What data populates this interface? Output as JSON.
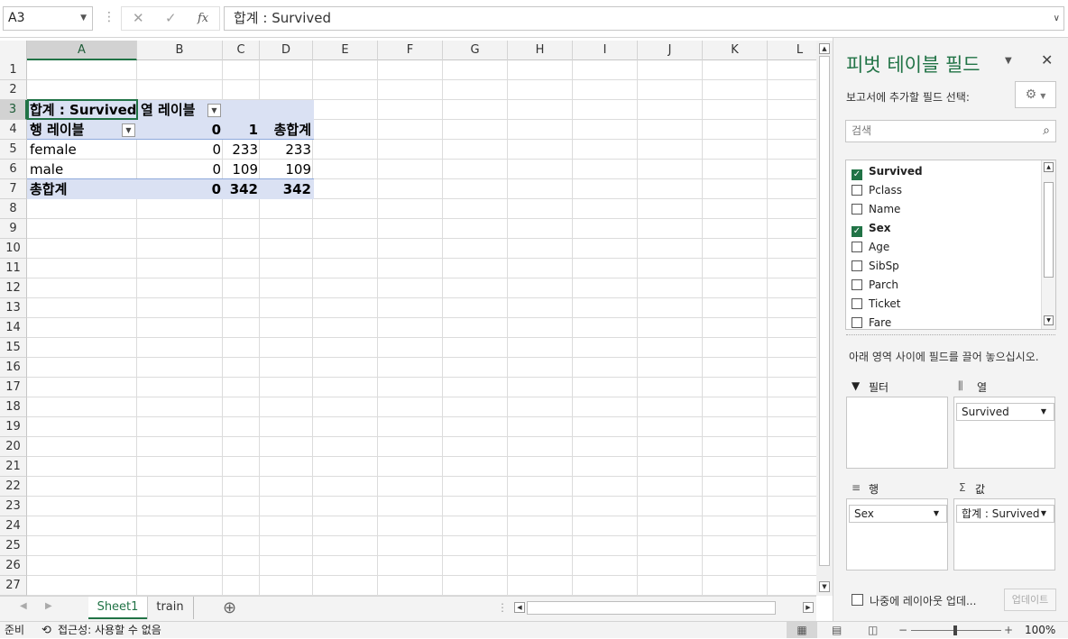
{
  "formula_bar": {
    "name_box": "A3",
    "cancel_icon": "✕",
    "enter_icon": "✓",
    "fx_icon": "fx",
    "formula": "합계 : Survived"
  },
  "sheet": {
    "columns": [
      "A",
      "B",
      "C",
      "D",
      "E",
      "F",
      "G",
      "H",
      "I",
      "J",
      "K",
      "L"
    ],
    "selected_column": "A",
    "rows": [
      "1",
      "2",
      "3",
      "4",
      "5",
      "6",
      "7",
      "8",
      "9",
      "10",
      "11",
      "12",
      "13",
      "14",
      "15",
      "16",
      "17",
      "18",
      "19",
      "20",
      "21",
      "22",
      "23",
      "24",
      "25",
      "26",
      "27"
    ],
    "selected_row": "3",
    "pivot": {
      "value_header": "합계 : Survived",
      "col_labels_header": "열 레이블",
      "row_labels_header": "행 레이블",
      "col_values": [
        "0",
        "1",
        "총합계"
      ],
      "rows": [
        {
          "label": "female",
          "values": [
            "0",
            "233",
            "233"
          ]
        },
        {
          "label": "male",
          "values": [
            "0",
            "109",
            "109"
          ]
        }
      ],
      "total": {
        "label": "총합계",
        "values": [
          "0",
          "342",
          "342"
        ]
      }
    },
    "tabs": [
      "Sheet1",
      "train"
    ],
    "active_tab": "Sheet1",
    "add_sheet_icon": "⊕"
  },
  "status": {
    "ready": "준비",
    "accessibility": "접근성: 사용할 수 없음",
    "zoom": "100%"
  },
  "panel": {
    "title": "피벗 테이블 필드",
    "subtitle": "보고서에 추가할 필드 선택:",
    "search_placeholder": "검색",
    "fields": [
      {
        "name": "Survived",
        "checked": true
      },
      {
        "name": "Pclass",
        "checked": false
      },
      {
        "name": "Name",
        "checked": false
      },
      {
        "name": "Sex",
        "checked": true
      },
      {
        "name": "Age",
        "checked": false
      },
      {
        "name": "SibSp",
        "checked": false
      },
      {
        "name": "Parch",
        "checked": false
      },
      {
        "name": "Ticket",
        "checked": false
      },
      {
        "name": "Fare",
        "checked": false
      }
    ],
    "drag_hint": "아래 영역 사이에 필드를 끌어 놓으십시오.",
    "zones": {
      "filter_label": "필터",
      "columns_label": "열",
      "rows_label": "행",
      "values_label": "값",
      "columns_item": "Survived",
      "rows_item": "Sex",
      "values_item": "합계 : Survived"
    },
    "defer_label": "나중에 레이아웃 업데...",
    "update_button": "업데이트"
  }
}
